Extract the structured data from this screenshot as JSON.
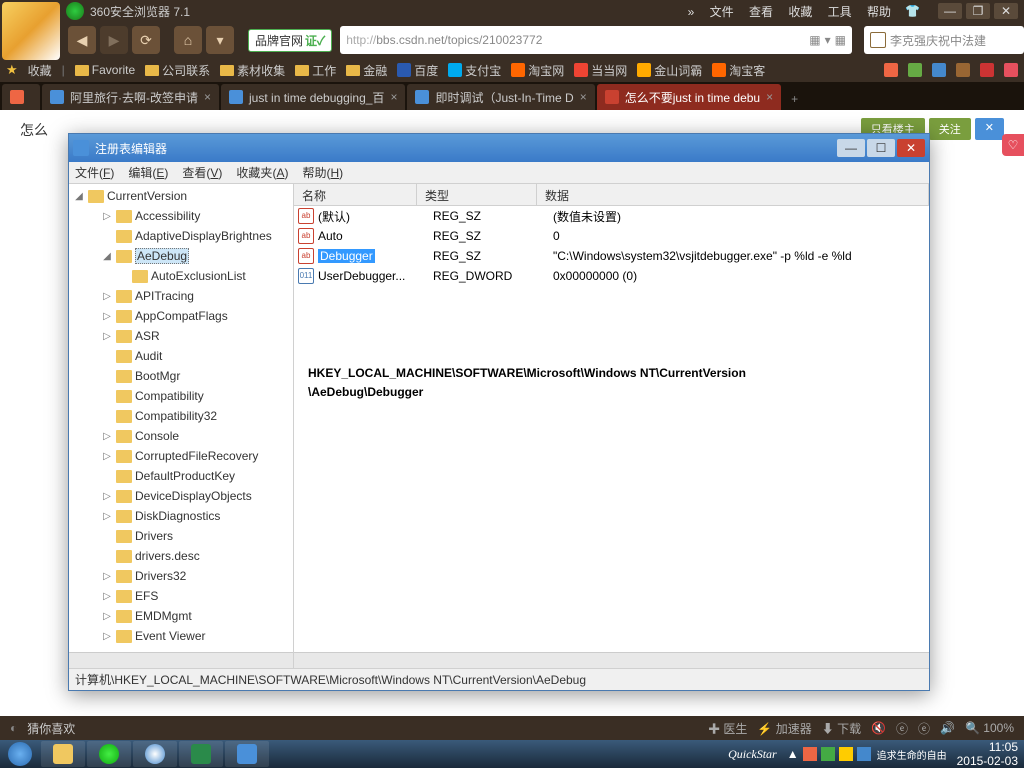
{
  "browser": {
    "title": "360安全浏览器 7.1",
    "top_menu": [
      "»",
      "文件",
      "查看",
      "收藏",
      "工具",
      "帮助"
    ],
    "brand_badge": "品牌官网",
    "url_protocol": "http://",
    "url_rest": "bbs.csdn.net/topics/210023772",
    "search_placeholder": "李克强庆祝中法建",
    "bookmarks_label": "收藏",
    "bookmarks": [
      "Favorite",
      "公司联系",
      "素材收集",
      "工作",
      "金融",
      "百度",
      "支付宝",
      "淘宝网",
      "当当网",
      "金山词霸",
      "淘宝客"
    ],
    "tabs": [
      {
        "label": "",
        "active": false
      },
      {
        "label": "阿里旅行·去啊-改签申请",
        "active": false
      },
      {
        "label": "just in time debugging_百",
        "active": false
      },
      {
        "label": "即时调试（Just-In-Time D",
        "active": false
      },
      {
        "label": "怎么不要just in time debu",
        "active": true
      }
    ],
    "page_title_partial": "怎么",
    "page_buttons": [
      "只看楼主",
      "关注"
    ],
    "status_left": "猜你喜欢",
    "status_items": [
      "医生",
      "加速器",
      "下载",
      "ℯ",
      "ℯ"
    ],
    "zoom": "100%"
  },
  "regedit": {
    "title": "注册表编辑器",
    "menu": [
      {
        "label": "文件",
        "key": "F"
      },
      {
        "label": "编辑",
        "key": "E"
      },
      {
        "label": "查看",
        "key": "V"
      },
      {
        "label": "收藏夹",
        "key": "A"
      },
      {
        "label": "帮助",
        "key": "H"
      }
    ],
    "tree_root": "CurrentVersion",
    "tree_items": [
      {
        "label": "Accessibility",
        "indent": 2,
        "exp": "▷"
      },
      {
        "label": "AdaptiveDisplayBrightnes",
        "indent": 2,
        "exp": ""
      },
      {
        "label": "AeDebug",
        "indent": 2,
        "exp": "◢",
        "sel": true
      },
      {
        "label": "AutoExclusionList",
        "indent": 3,
        "exp": ""
      },
      {
        "label": "APITracing",
        "indent": 2,
        "exp": "▷"
      },
      {
        "label": "AppCompatFlags",
        "indent": 2,
        "exp": "▷"
      },
      {
        "label": "ASR",
        "indent": 2,
        "exp": "▷"
      },
      {
        "label": "Audit",
        "indent": 2,
        "exp": ""
      },
      {
        "label": "BootMgr",
        "indent": 2,
        "exp": ""
      },
      {
        "label": "Compatibility",
        "indent": 2,
        "exp": ""
      },
      {
        "label": "Compatibility32",
        "indent": 2,
        "exp": ""
      },
      {
        "label": "Console",
        "indent": 2,
        "exp": "▷"
      },
      {
        "label": "CorruptedFileRecovery",
        "indent": 2,
        "exp": "▷"
      },
      {
        "label": "DefaultProductKey",
        "indent": 2,
        "exp": ""
      },
      {
        "label": "DeviceDisplayObjects",
        "indent": 2,
        "exp": "▷"
      },
      {
        "label": "DiskDiagnostics",
        "indent": 2,
        "exp": "▷"
      },
      {
        "label": "Drivers",
        "indent": 2,
        "exp": ""
      },
      {
        "label": "drivers.desc",
        "indent": 2,
        "exp": ""
      },
      {
        "label": "Drivers32",
        "indent": 2,
        "exp": "▷"
      },
      {
        "label": "EFS",
        "indent": 2,
        "exp": "▷"
      },
      {
        "label": "EMDMgmt",
        "indent": 2,
        "exp": "▷"
      },
      {
        "label": "Event Viewer",
        "indent": 2,
        "exp": "▷"
      }
    ],
    "columns": [
      "名称",
      "类型",
      "数据"
    ],
    "values": [
      {
        "name": "(默认)",
        "type": "REG_SZ",
        "data": "(数值未设置)",
        "icon": "ab"
      },
      {
        "name": "Auto",
        "type": "REG_SZ",
        "data": "0",
        "icon": "ab"
      },
      {
        "name": "Debugger",
        "type": "REG_SZ",
        "data": "\"C:\\Windows\\system32\\vsjitdebugger.exe\" -p %ld -e %ld",
        "icon": "ab",
        "sel": true
      },
      {
        "name": "UserDebugger...",
        "type": "REG_DWORD",
        "data": "0x00000000 (0)",
        "icon": "dw"
      }
    ],
    "overlay_path_line1": "HKEY_LOCAL_MACHINE\\SOFTWARE\\Microsoft\\Windows NT\\CurrentVersion",
    "overlay_path_line2": "\\AeDebug\\Debugger",
    "status_path": "计算机\\HKEY_LOCAL_MACHINE\\SOFTWARE\\Microsoft\\Windows NT\\CurrentVersion\\AeDebug"
  },
  "taskbar": {
    "quickstar": "QuickStar",
    "motto": "追求生命的自由",
    "time": "11:05",
    "date": "2015-02-03"
  }
}
